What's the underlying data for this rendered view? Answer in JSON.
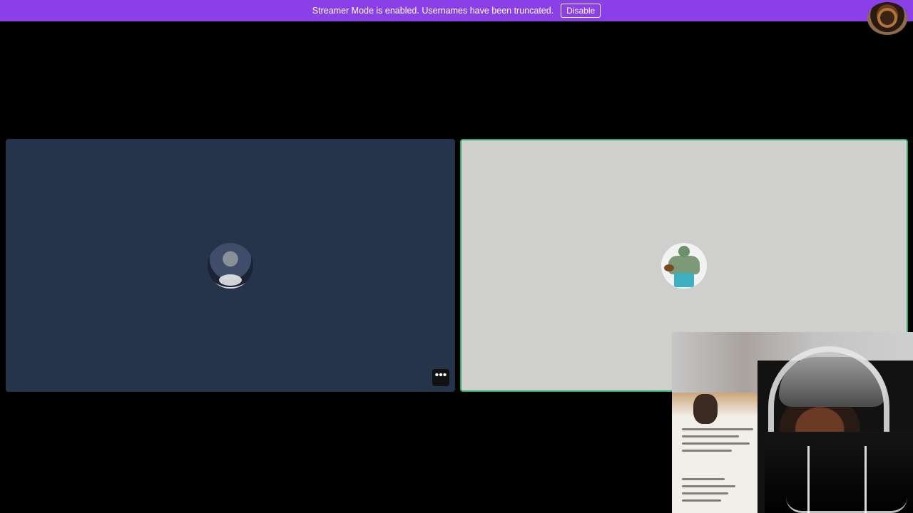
{
  "banner": {
    "message": "Streamer Mode is enabled. Usernames have been truncated.",
    "disable_label": "Disable",
    "background": "#8b3fe6"
  },
  "call": {
    "tiles": [
      {
        "background": "#26344b",
        "speaking": false
      },
      {
        "background": "#cfd0ce",
        "speaking": true,
        "border_color": "#2ca86b"
      }
    ],
    "more_label": "•••"
  }
}
